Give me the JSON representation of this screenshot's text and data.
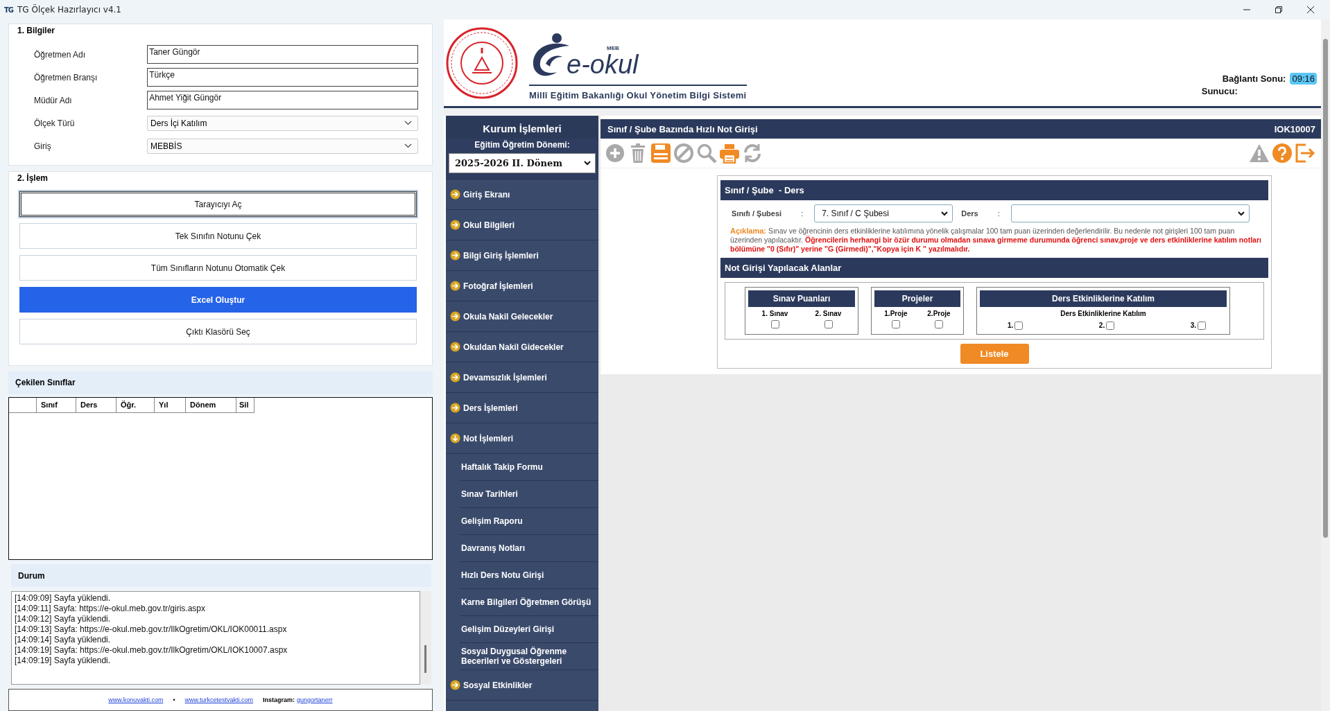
{
  "window": {
    "app_icon": "TG",
    "title": "TG Ölçek Hazırlayıcı v4.1"
  },
  "info_group": {
    "title": "1. Bilgiler",
    "fields": [
      {
        "label": "Öğretmen Adı",
        "kind": "text",
        "value": "Taner Güngör"
      },
      {
        "label": "Öğretmen Branşı",
        "kind": "text",
        "value": "Türkçe"
      },
      {
        "label": "Müdür Adı",
        "kind": "text",
        "value": "Ahmet Yiğit Güngör"
      },
      {
        "label": "Ölçek Türü",
        "kind": "select",
        "value": "Ders İçi Katılım"
      },
      {
        "label": "Giriş",
        "kind": "select",
        "value": "MEBBİS"
      }
    ]
  },
  "process_group": {
    "title": "2. İşlem",
    "buttons": [
      {
        "label": "Tarayıcıyı Aç",
        "kind": "focused"
      },
      {
        "label": "Tek Sınıfın Notunu Çek",
        "kind": "normal"
      },
      {
        "label": "Tüm Sınıfların Notunu Otomatik Çek",
        "kind": "normal"
      },
      {
        "label": "Excel Oluştur",
        "kind": "primary"
      },
      {
        "label": "Çıktı Klasörü Seç",
        "kind": "normal"
      }
    ]
  },
  "classes": {
    "title": "Çekilen Sınıflar",
    "columns": [
      "Sınıf",
      "Ders",
      "Öğr.",
      "Yıl",
      "Dönem",
      "Sil"
    ]
  },
  "status": {
    "title": "Durum",
    "log": [
      "[14:09:09] Sayfa yüklendi.",
      "[14:09:11] Sayfa: https://e-okul.meb.gov.tr/giris.aspx",
      "[14:09:12] Sayfa yüklendi.",
      "[14:09:13] Sayfa: https://e-okul.meb.gov.tr/IlkOgretim/OKL/IOK00011.aspx",
      "[14:09:14] Sayfa yüklendi.",
      "[14:09:19] Sayfa: https://e-okul.meb.gov.tr/IlkOgretim/OKL/IOK10007.aspx",
      "[14:09:19] Sayfa yüklendi."
    ]
  },
  "footer": {
    "links": [
      "www.konuvakti.com",
      "www.turkcetestvakti.com"
    ],
    "separator": "•",
    "instagram_label": "Instagram:",
    "instagram_handle": "gungortanerr"
  },
  "browser": {
    "header": {
      "brand_top": "MEB",
      "brand": "e-okul",
      "subtitle": "Millî Eğitim Bakanlığı Okul Yönetim Bilgi Sistemi",
      "connection_label": "Bağlantı Sonu:",
      "connection_time": "09:16",
      "server_label": "Sunucu:"
    },
    "sidebar": {
      "title": "Kurum İşlemleri",
      "term_label": "Eğitim Öğretim Dönemi:",
      "term_value": "2025-2026 II. Dönem",
      "items": [
        {
          "label": "Giriş Ekranı",
          "expanded": false
        },
        {
          "label": "Okul Bilgileri",
          "expanded": false
        },
        {
          "label": "Bilgi Giriş İşlemleri",
          "expanded": false
        },
        {
          "label": "Fotoğraf İşlemleri",
          "expanded": false
        },
        {
          "label": "Okula Nakil Gelecekler",
          "expanded": false
        },
        {
          "label": "Okuldan Nakil Gidecekler",
          "expanded": false
        },
        {
          "label": "Devamsızlık İşlemleri",
          "expanded": false
        },
        {
          "label": "Ders İşlemleri",
          "expanded": false
        },
        {
          "label": "Not İşlemleri",
          "expanded": true,
          "children": [
            {
              "label": "Haftalık Takip Formu"
            },
            {
              "label": "Sınav Tarihleri"
            },
            {
              "label": "Gelişim Raporu"
            },
            {
              "label": "Davranış Notları"
            },
            {
              "label": "Hızlı Ders Notu Girişi"
            },
            {
              "label": "Karne Bilgileri Öğretmen Görüşü"
            },
            {
              "label": "Gelişim Düzeyleri Girişi"
            },
            {
              "label": "Sosyal Duygusal Öğrenme Becerileri ve Göstergeleri"
            }
          ]
        },
        {
          "label": "Sosyal Etkinlikler",
          "expanded": false
        }
      ]
    },
    "page": {
      "title": "Sınıf / Şube Bazında Hızlı Not Girişi",
      "code": "IOK10007",
      "toolbar": [
        {
          "kind": "add",
          "enabled": false
        },
        {
          "kind": "delete",
          "enabled": false
        },
        {
          "kind": "save",
          "enabled": true
        },
        {
          "kind": "cancel",
          "enabled": false
        },
        {
          "kind": "search",
          "enabled": false
        },
        {
          "kind": "print",
          "enabled": true
        },
        {
          "kind": "refresh",
          "enabled": false
        }
      ],
      "toolbar_right": [
        {
          "kind": "warning",
          "enabled": false
        },
        {
          "kind": "help",
          "enabled": true
        },
        {
          "kind": "exit",
          "enabled": true
        }
      ],
      "section_title": "Sınıf / Şube  - Ders",
      "class_label": "Sınıfı / Şubesi",
      "colon": ":",
      "class_value": "7. Sınıf / C Şubesi",
      "lesson_label": "Ders",
      "note_label": "Açıklama:",
      "note_text": "Sınav ve öğrencinin ders etkinliklerine katılımına yönelik çalışmalar 100 tam puan üzerinden değerlendirilir. Bu nedenle not girişleri 100 tam puan üzerinden yapılacaktır.",
      "note_warning": "Öğrencilerin herhangi bir özür durumu olmadan sınava girmeme durumunda öğrenci sınav,proje ve ders etkinliklerine katılım notları bölümüne \"0 (Sıfır)\" yerine \"G (Girmedi)\",\"Kopya için K \" yazılmalıdır.",
      "areas_title": "Not Girişi Yapılacak Alanlar",
      "groups": [
        {
          "title": "Sınav Puanları",
          "kind": "stacked",
          "options": [
            {
              "label": "1. Sınav",
              "checked": false
            },
            {
              "label": "2. Sınav",
              "checked": false
            }
          ]
        },
        {
          "title": "Projeler",
          "kind": "stacked",
          "options": [
            {
              "label": "1.Proje",
              "checked": false
            },
            {
              "label": "2.Proje",
              "checked": false
            }
          ]
        },
        {
          "title": "Ders Etkinliklerine Katılım",
          "subtitle": "Ders Etkinliklerine Katılım",
          "kind": "inline",
          "options": [
            {
              "label": "1.",
              "checked": false
            },
            {
              "label": "2.",
              "checked": false
            },
            {
              "label": "3.",
              "checked": false
            }
          ]
        }
      ],
      "list_button": "Listele"
    }
  }
}
